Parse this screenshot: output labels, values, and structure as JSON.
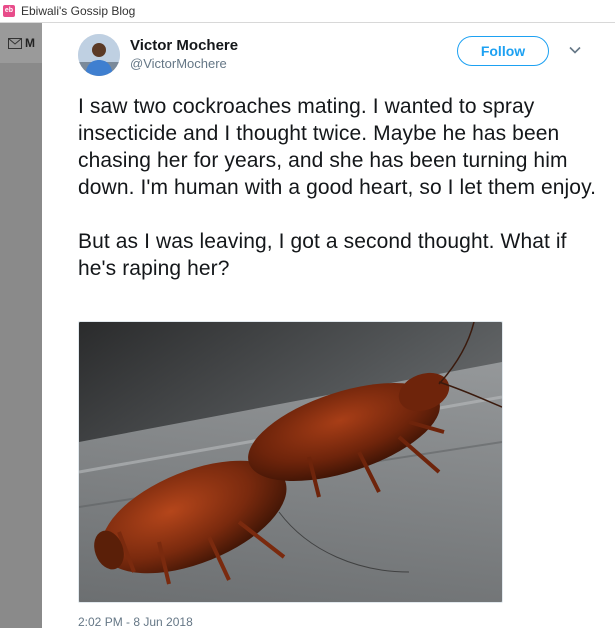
{
  "window": {
    "tab_title": "Ebiwali's Gossip Blog",
    "favicon_glyph": "eb"
  },
  "sidebar": {
    "mail_label": "M",
    "mail_icon": "mail-icon"
  },
  "tweet": {
    "author_name": "Victor Mochere",
    "author_handle": "@VictorMochere",
    "follow_label": "Follow",
    "text": "I saw two cockroaches mating. I wanted to spray insecticide and I thought twice. Maybe he has been chasing her for years, and she has been turning him down. I'm human with a good heart, so I let them enjoy.\n\nBut as I was leaving, I got a second thought. What if he's raping her?",
    "timestamp": "2:02 PM - 8 Jun 2018",
    "media": "photo of two cockroaches",
    "colors": {
      "accent": "#1da1f2",
      "muted": "#657786"
    }
  }
}
